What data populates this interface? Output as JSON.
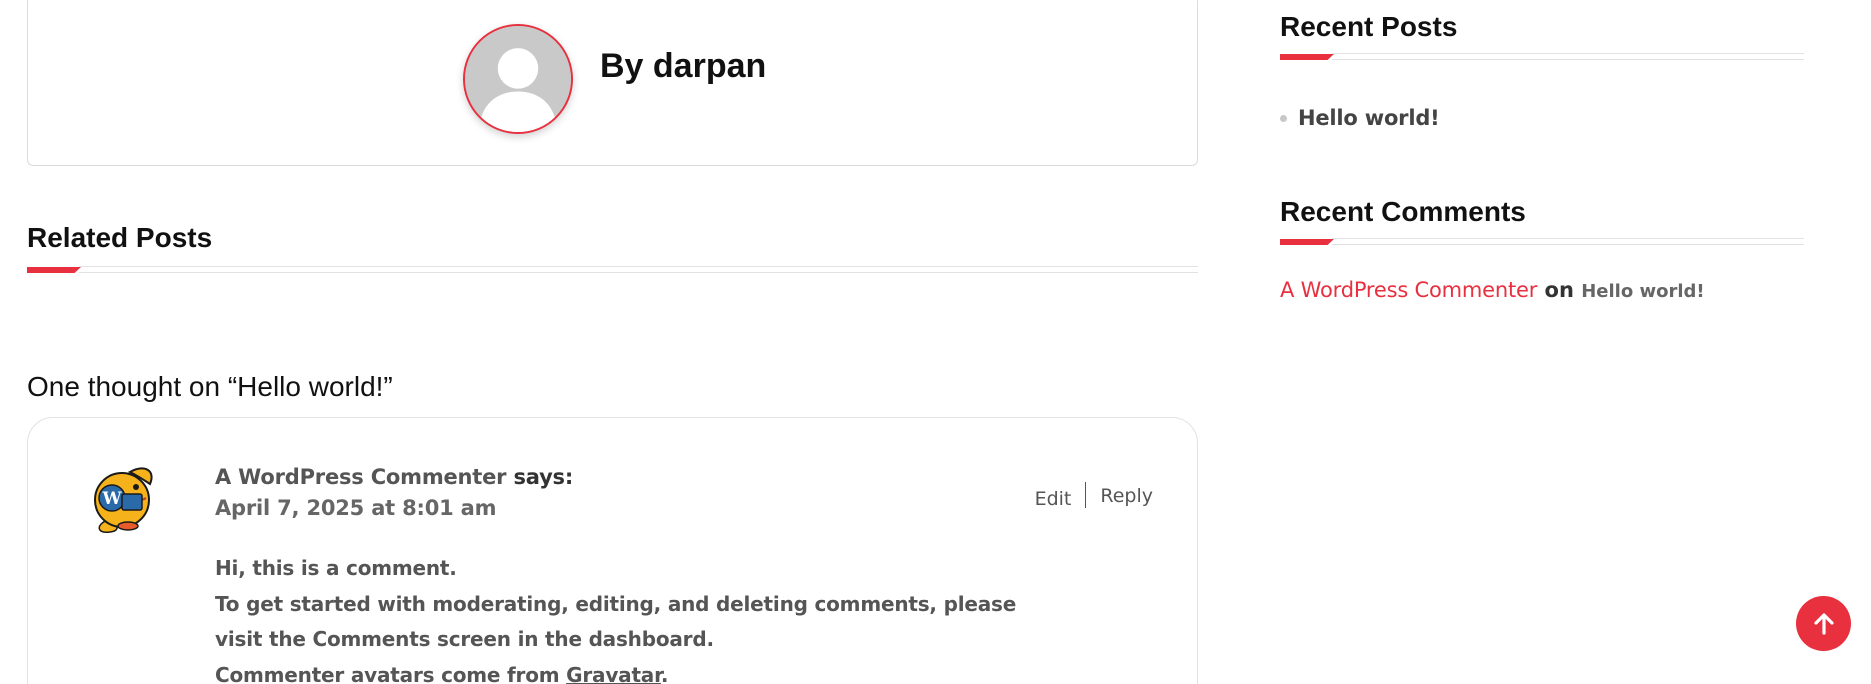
{
  "author_box": {
    "byline": "By darpan",
    "avatar_icon": "default-user-avatar"
  },
  "related_posts": {
    "heading": "Related Posts"
  },
  "comments": {
    "title": "One thought on “Hello world!”",
    "items": [
      {
        "author": "A WordPress Commenter",
        "says": " says:",
        "date": "April 7, 2025 at 8:01 am",
        "edit_label": "Edit",
        "reply_label": "Reply",
        "avatar_icon": "wapuu-avatar",
        "lines": [
          "Hi, this is a comment.",
          "To get started with moderating, editing, and deleting comments, please visit the Comments screen in the dashboard.",
          "Commenter avatars come from "
        ],
        "link_text": "Gravatar",
        "trailing": "."
      }
    ]
  },
  "sidebar": {
    "recent_posts": {
      "heading": "Recent Posts",
      "items": [
        "Hello world!"
      ]
    },
    "recent_comments": {
      "heading": "Recent Comments",
      "items": [
        {
          "author": "A WordPress Commenter",
          "connector": " on ",
          "post": "Hello world!"
        }
      ]
    }
  },
  "scroll_top": {
    "icon": "arrow-up-icon"
  },
  "colors": {
    "accent": "#e8303f",
    "text": "#111111",
    "muted": "#555555",
    "border": "#dcdcdc"
  }
}
